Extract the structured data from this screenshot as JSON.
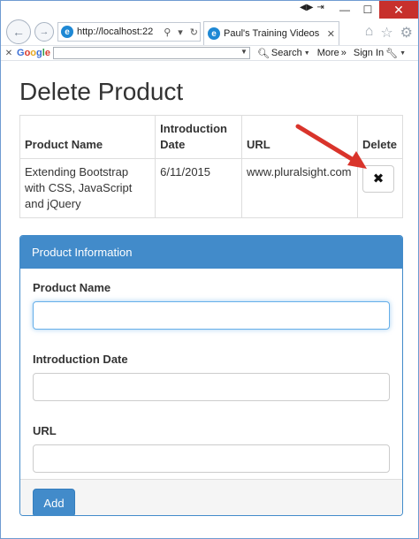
{
  "browser": {
    "address": "http://localhost:22",
    "tab_title": "Paul's Training Videos",
    "google_label": "Google",
    "search_label": "Search",
    "more_label": "More",
    "signin_label": "Sign In"
  },
  "page": {
    "title": "Delete Product"
  },
  "table": {
    "headers": [
      "Product Name",
      "Introduction Date",
      "URL",
      "Delete"
    ],
    "rows": [
      {
        "name": "Extending Bootstrap with CSS, JavaScript and jQuery",
        "date": "6/11/2015",
        "url": "www.pluralsight.com"
      }
    ]
  },
  "panel": {
    "title": "Product Information",
    "fields": [
      {
        "label": "Product Name",
        "value": ""
      },
      {
        "label": "Introduction Date",
        "value": ""
      },
      {
        "label": "URL",
        "value": ""
      }
    ],
    "add_label": "Add"
  },
  "colors": {
    "primary": "#428bca",
    "arrow": "#d9342b"
  },
  "icons": {
    "delete": "x-mark"
  }
}
